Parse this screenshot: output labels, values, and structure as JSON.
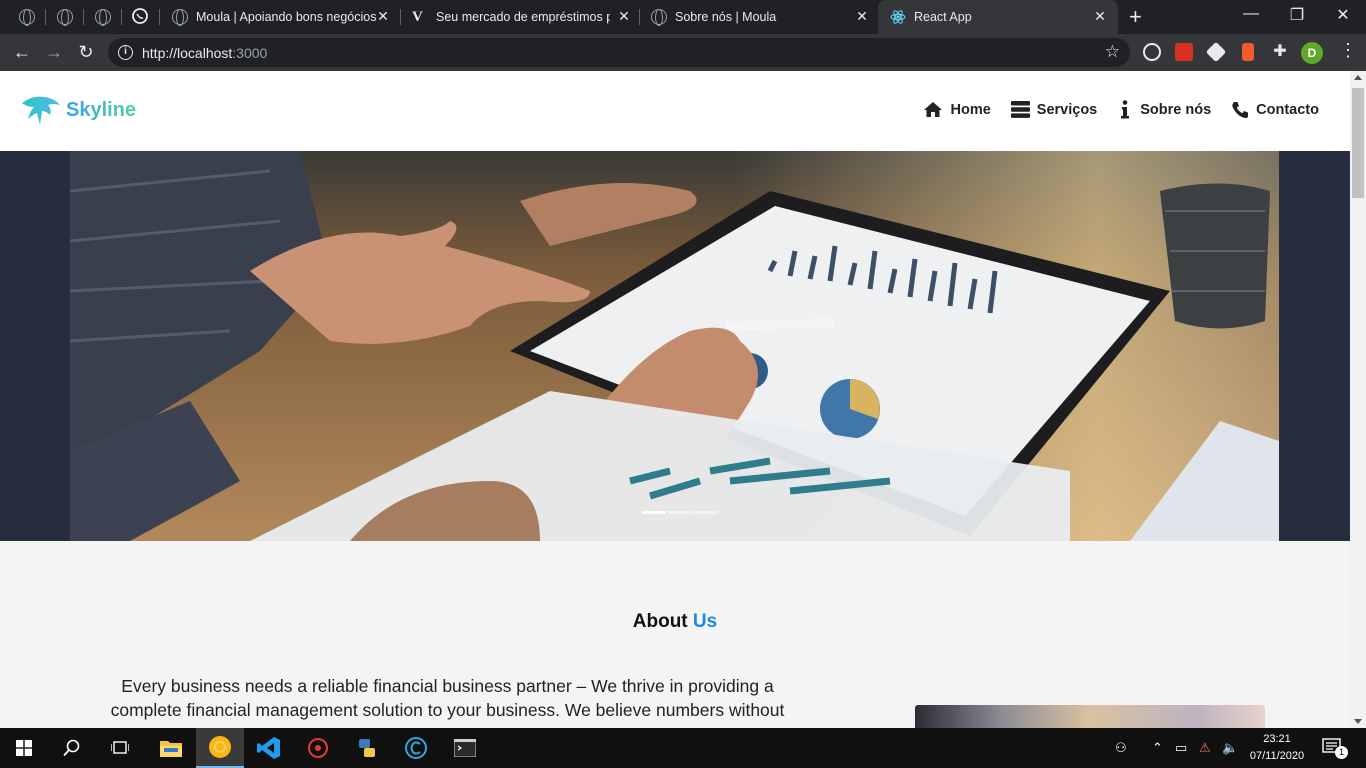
{
  "browser": {
    "tabs": [
      {
        "title": "Moula | Apoiando bons negócios",
        "active": false
      },
      {
        "title": "Seu mercado de empréstimos pa",
        "active": false
      },
      {
        "title": "Sobre nós | Moula",
        "active": false
      },
      {
        "title": "React App",
        "active": true
      }
    ],
    "url_scheme_host": "http://localhost",
    "url_port": ":3000",
    "profile_initial": "D"
  },
  "site": {
    "brand": "Skyline",
    "nav": [
      {
        "label": "Home",
        "icon": "home-icon"
      },
      {
        "label": "Serviços",
        "icon": "server-icon"
      },
      {
        "label": "Sobre nós",
        "icon": "info-icon"
      },
      {
        "label": "Contacto",
        "icon": "phone-icon"
      }
    ],
    "about": {
      "title_main": "About",
      "title_accent": "Us",
      "text": "Every business needs a reliable financial business partner – We thrive in providing a complete financial management solution to your business. We believe numbers without"
    },
    "carousel": {
      "slides": 3,
      "active": 0
    }
  },
  "taskbar": {
    "time": "23:21",
    "date": "07/11/2020",
    "notifications": "1"
  },
  "colors": {
    "accent": "#1e88e5",
    "hero_band": "#262d3f",
    "page_bg": "#f3f4f3"
  }
}
